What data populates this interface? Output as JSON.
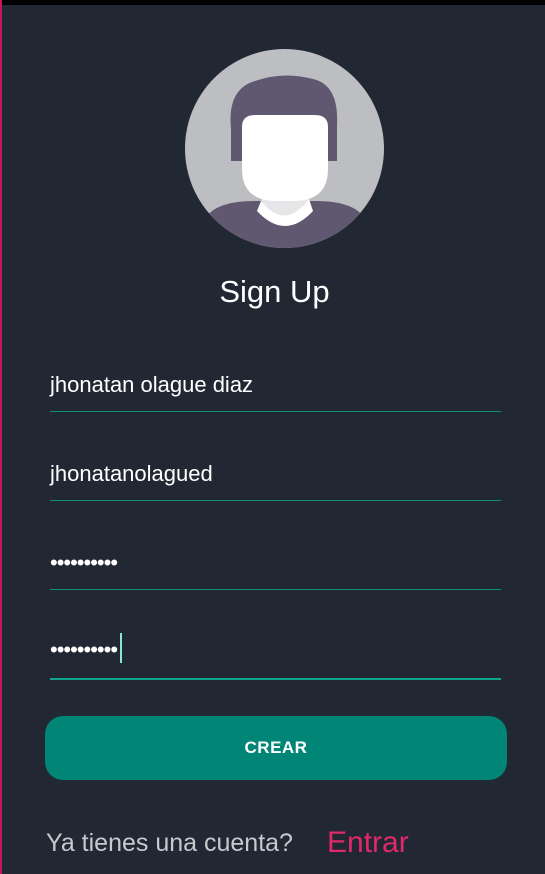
{
  "header": {
    "title": "Sign Up"
  },
  "avatar": {
    "icon": "default-user-avatar-icon",
    "colors": {
      "background": "#bdbec2",
      "hair": "#5f5870",
      "skin": "#ffffff"
    }
  },
  "form": {
    "name_value": "jhonatan olague diaz",
    "username_value": "jhonatanolagued",
    "password_value": "••••••••••",
    "confirm_password_value": "••••••••••"
  },
  "actions": {
    "create_label": "CREAR"
  },
  "footer": {
    "question": "Ya tienes una cuenta?",
    "login_link": "Entrar"
  },
  "colors": {
    "background": "#212733",
    "accent": "#018577",
    "underline": "#0f8f7a",
    "link": "#e0286b"
  }
}
